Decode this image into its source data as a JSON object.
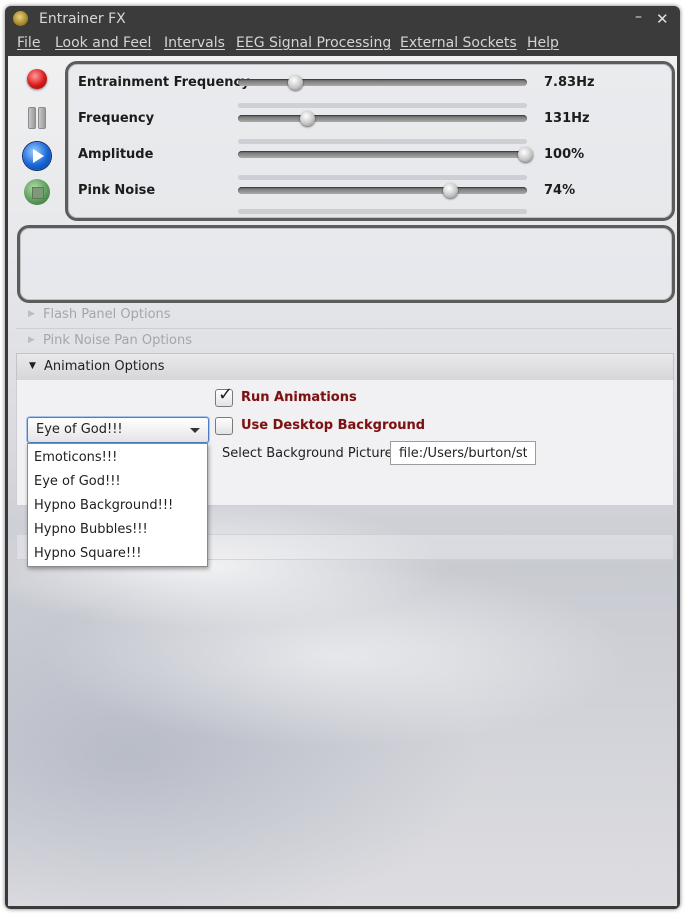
{
  "window": {
    "title": "Entrainer FX",
    "minimize_glyph": "–",
    "close_glyph": "✕"
  },
  "menu": {
    "file": "File",
    "look_and_feel": "Look and Feel",
    "intervals": "Intervals",
    "eeg": "EEG Signal Processing",
    "external_sockets": "External Sockets",
    "help": "Help"
  },
  "controls": [
    "record-icon",
    "pause-icon",
    "play-icon",
    "stop-icon"
  ],
  "sliders": [
    {
      "label": "Entrainment Frequency",
      "value": "7.83Hz",
      "position": 0.2
    },
    {
      "label": "Frequency",
      "value": "131Hz",
      "position": 0.24
    },
    {
      "label": "Amplitude",
      "value": "100%",
      "position": 1.0
    },
    {
      "label": "Pink Noise",
      "value": "74%",
      "position": 0.74
    }
  ],
  "accordion": {
    "flash": "Flash Panel Options",
    "pink_pan": "Pink Noise Pan Options",
    "animation": "Animation Options"
  },
  "animation": {
    "run_animations": "Run Animations",
    "run_checked": true,
    "use_desktop_bg": "Use Desktop Background",
    "desktop_checked": false,
    "select_bg_label": "Select Background Picture",
    "bg_path": "file:/Users/burton/st",
    "animation_selected": "Eye of God!!!",
    "animation_options": [
      "Emoticons!!!",
      "Eye of God!!!",
      "Hypno Background!!!",
      "Hypno Bubbles!!!",
      "Hypno Square!!!"
    ]
  }
}
